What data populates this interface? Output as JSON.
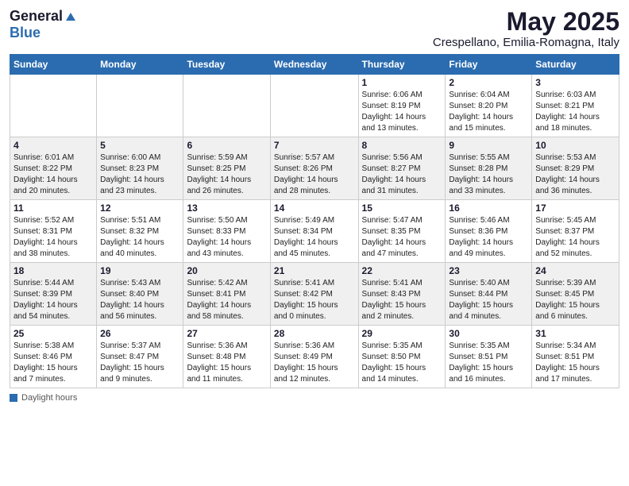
{
  "header": {
    "logo_general": "General",
    "logo_blue": "Blue",
    "month_title": "May 2025",
    "location": "Crespellano, Emilia-Romagna, Italy"
  },
  "days_of_week": [
    "Sunday",
    "Monday",
    "Tuesday",
    "Wednesday",
    "Thursday",
    "Friday",
    "Saturday"
  ],
  "weeks": [
    [
      {
        "num": "",
        "info": ""
      },
      {
        "num": "",
        "info": ""
      },
      {
        "num": "",
        "info": ""
      },
      {
        "num": "",
        "info": ""
      },
      {
        "num": "1",
        "info": "Sunrise: 6:06 AM\nSunset: 8:19 PM\nDaylight: 14 hours\nand 13 minutes."
      },
      {
        "num": "2",
        "info": "Sunrise: 6:04 AM\nSunset: 8:20 PM\nDaylight: 14 hours\nand 15 minutes."
      },
      {
        "num": "3",
        "info": "Sunrise: 6:03 AM\nSunset: 8:21 PM\nDaylight: 14 hours\nand 18 minutes."
      }
    ],
    [
      {
        "num": "4",
        "info": "Sunrise: 6:01 AM\nSunset: 8:22 PM\nDaylight: 14 hours\nand 20 minutes."
      },
      {
        "num": "5",
        "info": "Sunrise: 6:00 AM\nSunset: 8:23 PM\nDaylight: 14 hours\nand 23 minutes."
      },
      {
        "num": "6",
        "info": "Sunrise: 5:59 AM\nSunset: 8:25 PM\nDaylight: 14 hours\nand 26 minutes."
      },
      {
        "num": "7",
        "info": "Sunrise: 5:57 AM\nSunset: 8:26 PM\nDaylight: 14 hours\nand 28 minutes."
      },
      {
        "num": "8",
        "info": "Sunrise: 5:56 AM\nSunset: 8:27 PM\nDaylight: 14 hours\nand 31 minutes."
      },
      {
        "num": "9",
        "info": "Sunrise: 5:55 AM\nSunset: 8:28 PM\nDaylight: 14 hours\nand 33 minutes."
      },
      {
        "num": "10",
        "info": "Sunrise: 5:53 AM\nSunset: 8:29 PM\nDaylight: 14 hours\nand 36 minutes."
      }
    ],
    [
      {
        "num": "11",
        "info": "Sunrise: 5:52 AM\nSunset: 8:31 PM\nDaylight: 14 hours\nand 38 minutes."
      },
      {
        "num": "12",
        "info": "Sunrise: 5:51 AM\nSunset: 8:32 PM\nDaylight: 14 hours\nand 40 minutes."
      },
      {
        "num": "13",
        "info": "Sunrise: 5:50 AM\nSunset: 8:33 PM\nDaylight: 14 hours\nand 43 minutes."
      },
      {
        "num": "14",
        "info": "Sunrise: 5:49 AM\nSunset: 8:34 PM\nDaylight: 14 hours\nand 45 minutes."
      },
      {
        "num": "15",
        "info": "Sunrise: 5:47 AM\nSunset: 8:35 PM\nDaylight: 14 hours\nand 47 minutes."
      },
      {
        "num": "16",
        "info": "Sunrise: 5:46 AM\nSunset: 8:36 PM\nDaylight: 14 hours\nand 49 minutes."
      },
      {
        "num": "17",
        "info": "Sunrise: 5:45 AM\nSunset: 8:37 PM\nDaylight: 14 hours\nand 52 minutes."
      }
    ],
    [
      {
        "num": "18",
        "info": "Sunrise: 5:44 AM\nSunset: 8:39 PM\nDaylight: 14 hours\nand 54 minutes."
      },
      {
        "num": "19",
        "info": "Sunrise: 5:43 AM\nSunset: 8:40 PM\nDaylight: 14 hours\nand 56 minutes."
      },
      {
        "num": "20",
        "info": "Sunrise: 5:42 AM\nSunset: 8:41 PM\nDaylight: 14 hours\nand 58 minutes."
      },
      {
        "num": "21",
        "info": "Sunrise: 5:41 AM\nSunset: 8:42 PM\nDaylight: 15 hours\nand 0 minutes."
      },
      {
        "num": "22",
        "info": "Sunrise: 5:41 AM\nSunset: 8:43 PM\nDaylight: 15 hours\nand 2 minutes."
      },
      {
        "num": "23",
        "info": "Sunrise: 5:40 AM\nSunset: 8:44 PM\nDaylight: 15 hours\nand 4 minutes."
      },
      {
        "num": "24",
        "info": "Sunrise: 5:39 AM\nSunset: 8:45 PM\nDaylight: 15 hours\nand 6 minutes."
      }
    ],
    [
      {
        "num": "25",
        "info": "Sunrise: 5:38 AM\nSunset: 8:46 PM\nDaylight: 15 hours\nand 7 minutes."
      },
      {
        "num": "26",
        "info": "Sunrise: 5:37 AM\nSunset: 8:47 PM\nDaylight: 15 hours\nand 9 minutes."
      },
      {
        "num": "27",
        "info": "Sunrise: 5:36 AM\nSunset: 8:48 PM\nDaylight: 15 hours\nand 11 minutes."
      },
      {
        "num": "28",
        "info": "Sunrise: 5:36 AM\nSunset: 8:49 PM\nDaylight: 15 hours\nand 12 minutes."
      },
      {
        "num": "29",
        "info": "Sunrise: 5:35 AM\nSunset: 8:50 PM\nDaylight: 15 hours\nand 14 minutes."
      },
      {
        "num": "30",
        "info": "Sunrise: 5:35 AM\nSunset: 8:51 PM\nDaylight: 15 hours\nand 16 minutes."
      },
      {
        "num": "31",
        "info": "Sunrise: 5:34 AM\nSunset: 8:51 PM\nDaylight: 15 hours\nand 17 minutes."
      }
    ]
  ],
  "footer": {
    "legend_label": "Daylight hours"
  }
}
